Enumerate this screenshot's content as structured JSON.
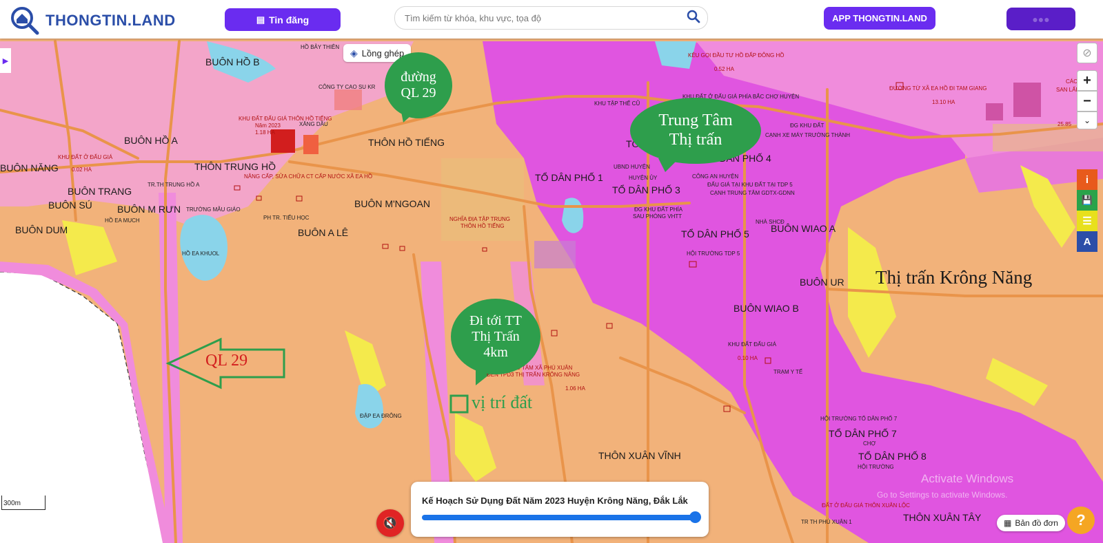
{
  "header": {
    "logo_text": "THONGTIN.LAND",
    "post_button": "Tin đăng",
    "search_placeholder": "Tìm kiếm từ khóa, khu vực, tọa độ",
    "app_button": "APP THONGTIN.LAND"
  },
  "map": {
    "layer_button": "Lồng ghép",
    "area_labels": [
      "BUÔN HỒ B",
      "BUÔN HỒ A",
      "BUÔN NĂNG",
      "BUÔN TRANG",
      "BUÔN SÚ",
      "BUÔN M RƯN",
      "BUÔN DUM",
      "THÔN TRUNG HỒ",
      "THÔN HỒ TIẾNG",
      "BUÔN M'NGOAN",
      "BUÔN A LÊ",
      "TỔ DÂN PHỐ 1",
      "TỔ DÂN PHỐ 3",
      "TỔ DÂN PHỐ 4",
      "TỔ DÂN PHỐ 5",
      "BUÔN WIAO A",
      "BUÔN UR",
      "BUÔN WIAO B",
      "TỔ DÂN PHỐ 7",
      "TỔ DÂN PHỐ 8",
      "THÔN XUÂN VĨNH",
      "THÔN XUÂN TÂY",
      "TỔ DÂ"
    ],
    "small_labels": [
      "HỒ BẢY THIÊN",
      "CÔNG TY CAO SU KR",
      "XĂNG DẦU",
      "KHU ĐẤT ĐẤU GIÁ THÔN HỒ TIẾNG",
      "Năm 2023",
      "1.18 HA",
      "KHU ĐẤT Ở ĐẤU GIÁ",
      "0.02 HA",
      "NÂNG CẤP, SỬA CHỮA CT CẤP NƯỚC XÃ EA HỒ",
      "TR.TH TRUNG HỒ A",
      "TRƯỜNG MẪU GIÁO",
      "HỒ EA MUCH",
      "PH TR. TIỂU HỌC",
      "HỒ EA KHUOL",
      "NGHĨA ĐỊA TẬP TRUNG",
      "THÔN HỒ TIẾNG",
      "KÊU GỌI ĐẦU TƯ HỒ ĐẤP ĐÔNG HỒ",
      "0.52 HA",
      "KHU ĐẤT Ở ĐẤU GIÁ PHÍA BẮC CHỢ HUYỆN",
      "KHU TẬP THỂ CŨ",
      "ĐƯỜNG TỪ XÃ EA HỒ ĐI TAM GIANG",
      "13.10 HA",
      "CÁC M",
      "SAN LẤP Ô",
      "25.85",
      "ĐG KHU ĐẤT",
      "CẠNH XE MÁY TRƯỜNG THÀNH",
      "UBND HUYỆN",
      "HUYỆN ỦY",
      "CÔNG AN HUYỆN",
      "ĐẤU GIÁ TẠI KHU ĐẤT TẠI TDP 5",
      "CẠNH TRUNG TÂM GDTX-GDNN",
      "ĐG KHU ĐẤT PHÍA",
      "SAU PHÒNG VHTT",
      "NHÀ SHCĐ",
      "HỘI TRƯỜNG TDP 5",
      "KHU ĐẤT ĐẤU GIÁ",
      "0.10 HA",
      "TRẠM Y TẾ",
      "ĐT TỪ TRUNG TÂM XÃ PHÚ XUÂN",
      "ĐẾN TPD3 THỊ TRẤN KRÔNG NĂNG",
      "1.06 HA",
      "ĐẬP EA ĐRÔNG",
      "HỘI TRƯỜNG TỔ DÂN PHỐ 7",
      "CHỢ",
      "HỘI TRƯỜNG",
      "ĐẤT Ở ĐẤU GIÁ THÔN XUÂN LỘC",
      "TR TH PHÚ XUÂN 1"
    ],
    "annotations": {
      "bubble_road": "đường QL 29",
      "bubble_center": "Trung Tâm Thị trấn",
      "bubble_goto": "Đi tới TT Thị Trấn 4km",
      "arrow_label": "QL 29",
      "parcel_label": "vị trí đất",
      "town_label": "Thị trấn Krông Năng"
    },
    "scale": "300m",
    "watermark_line1": "Activate Windows",
    "watermark_line2": "Go to Settings to activate Windows."
  },
  "controls": {
    "zoom_in": "+",
    "zoom_out": "−",
    "info": "i",
    "save": "💾",
    "layers": "☰",
    "measure": "A"
  },
  "plan": {
    "title": "Kế Hoạch Sử Dụng Đất Năm 2023 Huyện Krông Năng, Đắk Lắk",
    "opacity_percent": 100
  },
  "footer": {
    "simple_map_button": "Bản đồ đơn",
    "help": "?"
  },
  "colors": {
    "accent": "#6a2cf0",
    "logo": "#2b4ea8",
    "land_orange": "#f2b27a",
    "land_pink": "#f08cdc",
    "urban_magenta": "#e055e0",
    "annotation_green": "#2e9e4c",
    "annotation_red": "#d21e1e"
  }
}
